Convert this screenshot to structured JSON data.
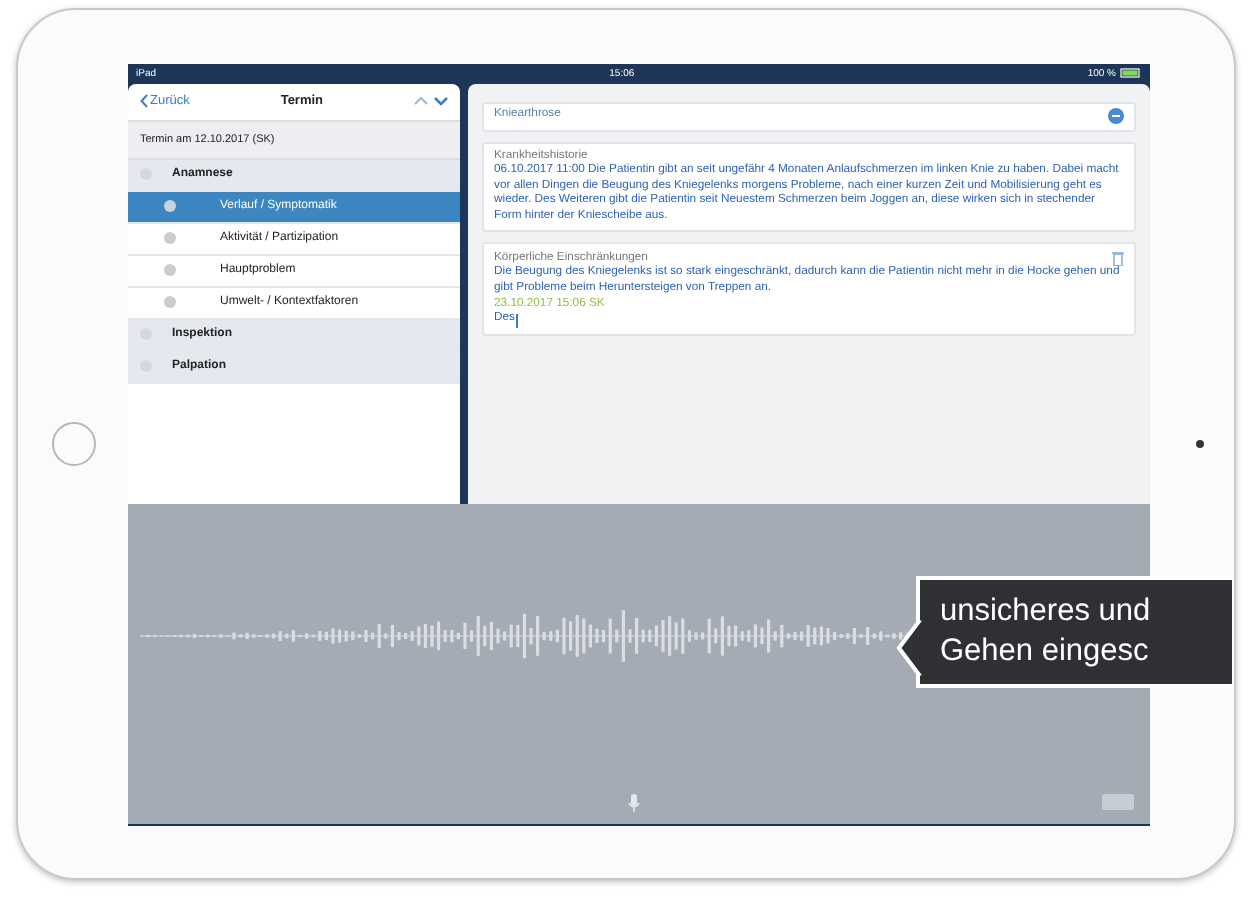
{
  "status_bar": {
    "carrier": "iPad",
    "time": "15:06",
    "battery": "100 %"
  },
  "nav": {
    "back": "Zurück",
    "title": "Termin",
    "appointment": "Termin am 12.10.2017 (SK)",
    "items": [
      {
        "kind": "section",
        "label": "Anamnese",
        "selected": false
      },
      {
        "kind": "subitem",
        "label": "Verlauf / Symptomatik",
        "selected": true
      },
      {
        "kind": "subitem",
        "label": "Aktivität / Partizipation",
        "selected": false
      },
      {
        "kind": "subitem",
        "label": "Hauptproblem",
        "selected": false
      },
      {
        "kind": "subitem",
        "label": "Umwelt- / Kontextfaktoren",
        "selected": false
      },
      {
        "kind": "section",
        "label": "Inspektion",
        "selected": false
      },
      {
        "kind": "section",
        "label": "Palpation",
        "selected": false
      }
    ]
  },
  "notes": {
    "diagnosis": "Kniearthrose",
    "cards": [
      {
        "title": "Krankheitshistorie",
        "text": "06.10.2017 11:00 Die Patientin gibt an seit ungefähr 4 Monaten Anlaufschmerzen im linken Knie zu haben. Dabei macht vor allen Dingen die Beugung des Kniegelenks morgens Probleme, nach einer kurzen Zeit und Mobilisierung geht es wieder. Des Weiteren gibt die Patientin seit Neuestem Schmerzen beim Joggen an, diese wirken sich in stechender Form hinter der Kniescheibe aus."
      },
      {
        "title": "Körperliche Einschränkungen",
        "text": "Die Beugung des Kniegelenks ist so stark eingeschränkt, dadurch kann die Patientin nicht mehr in die Hocke gehen und gibt Probleme beim Heruntersteigen von Treppen an.",
        "stamp": "23.10.2017 15:06 SK",
        "value": "Des"
      }
    ]
  },
  "dictation": {
    "tooltip": [
      "unsicheres und",
      "Gehen eingesc"
    ]
  }
}
